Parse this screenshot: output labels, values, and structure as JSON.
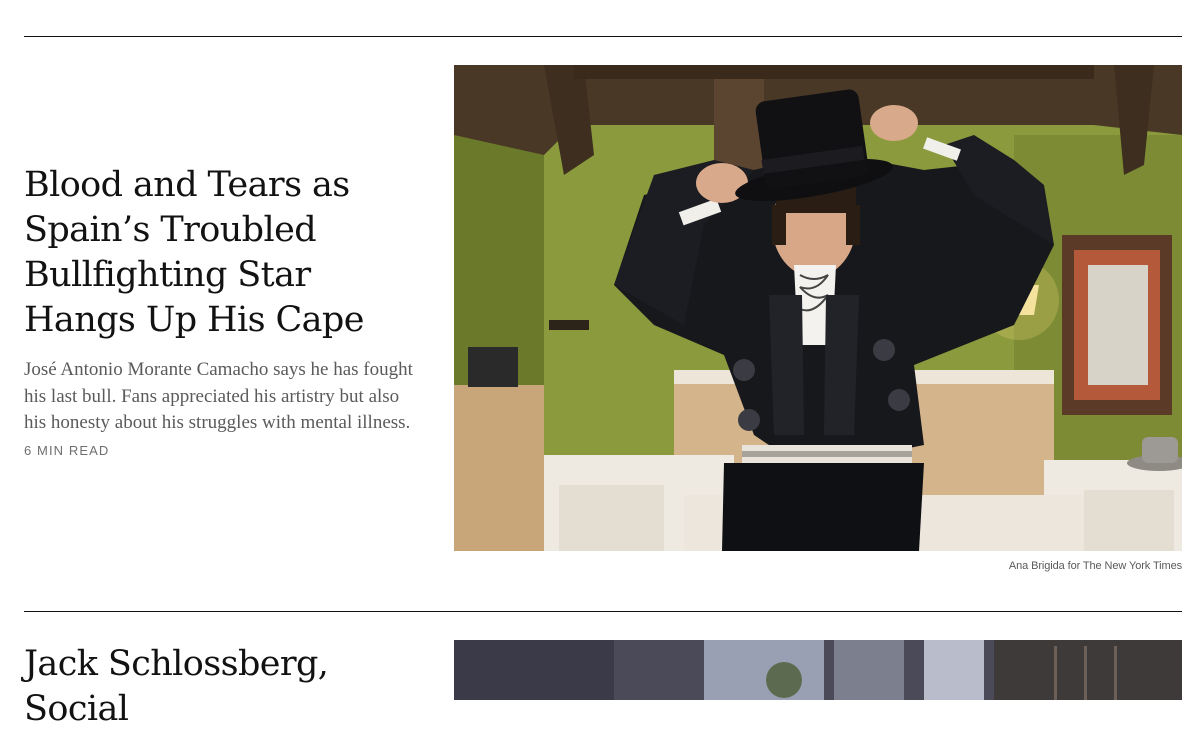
{
  "story1": {
    "headline": "Blood and Tears as Spain’s Troubled Bullfighting Star Hangs Up His Cape",
    "summary": "José Antonio Morante Camacho says he has fought his last bull. Fans appreciated his artistry but also his honesty about his struggles with mental illness.",
    "read_time": "6 MIN READ",
    "photo_credit": "Ana Brigida for The New York Times"
  },
  "story2": {
    "headline": "Jack Schlossberg, Social"
  }
}
